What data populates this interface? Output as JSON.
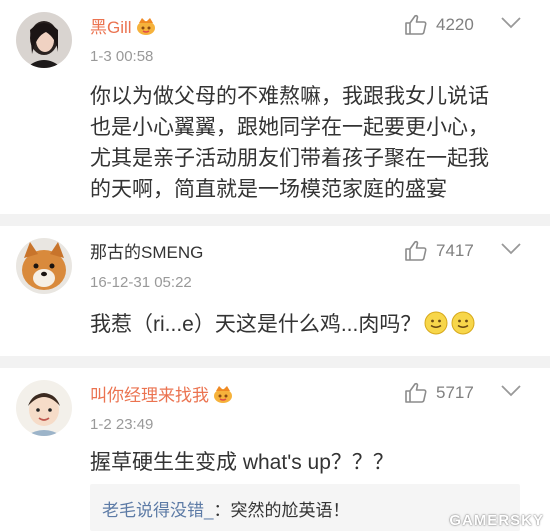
{
  "comments": [
    {
      "username": "黑Gill",
      "timestamp": "1-3 00:58",
      "likes": "4220",
      "text_lines": [
        "你以为做父母的不难熬嘛，我跟我女儿说话",
        "也是小心翼翼，跟她同学在一起要更小心，",
        "尤其是亲子活动朋友们带着孩子聚在一起我",
        "的天啊，简直就是一场模范家庭的盛宴"
      ]
    },
    {
      "username": "那古的SMENG",
      "timestamp": "16-12-31 05:22",
      "likes": "7417",
      "text": "我惹（ri...e）天这是什么鸡...肉吗？"
    },
    {
      "username": "叫你经理来找我",
      "timestamp": "1-2 23:49",
      "likes": "5717",
      "text": "握草硬生生变成 what's up？？？",
      "reply": {
        "user": "老毛说得没错_",
        "content": "：突然的尬英语！"
      }
    }
  ],
  "watermark": "GAMERSKY",
  "colors": {
    "username_highlight": "#eb7350",
    "reply_user": "#5d7ba6",
    "timestamp": "#999999",
    "divider": "#f2f2f2"
  },
  "icons": {
    "like": "thumbs-up-icon",
    "more": "chevron-down-icon",
    "badge": "crown-badge-icon",
    "emoji": "smiley-emoji-icon"
  }
}
